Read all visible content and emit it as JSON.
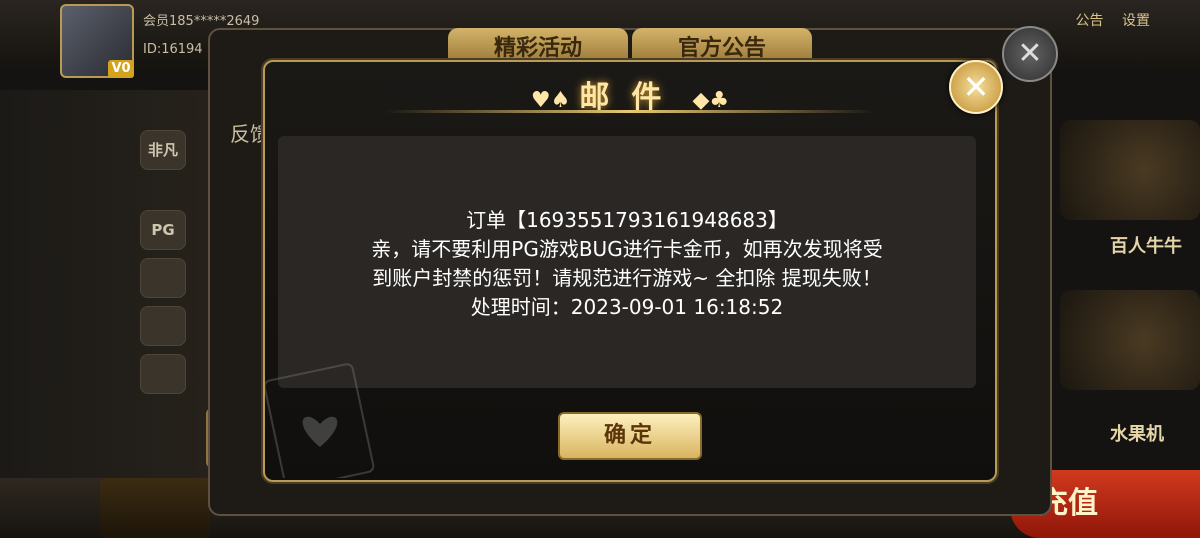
{
  "player": {
    "member": "会员185*****2649",
    "id": "ID:16194",
    "level_badge": "V0"
  },
  "top_bar": {
    "announcement_label": "公告",
    "settings_label": "设置"
  },
  "back_panel": {
    "tabs": [
      "精彩活动",
      "官方公告"
    ],
    "side_label": "反馈",
    "close_symbol": "✕"
  },
  "left_rail": {
    "category_label": "非凡",
    "pg_label": "PG"
  },
  "right_games": [
    "百人牛牛",
    "水果机"
  ],
  "recharge_label": "充值",
  "dialog": {
    "title": "邮件",
    "close_symbol": "✕",
    "message_lines": [
      "订单【1693551793161948683】",
      "亲，请不要利用PG游戏BUG进行卡金币，如再次发现将受",
      "到账户封禁的惩罚！请规范进行游戏~ 全扣除 提现失败！",
      "处理时间：2023-09-01 16:18:52"
    ],
    "confirm_label": "确定"
  },
  "icons": {
    "suit_left": "♥♠",
    "suit_right": "◆♣",
    "mail": "✉"
  }
}
